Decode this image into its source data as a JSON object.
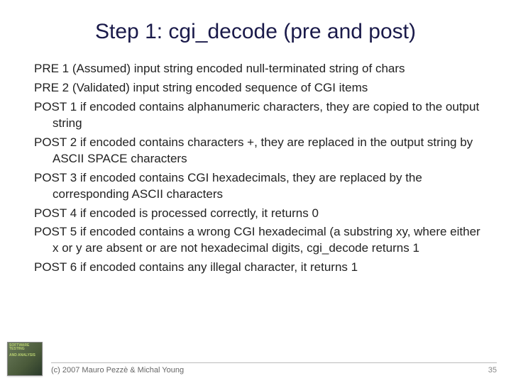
{
  "title": "Step 1: cgi_decode (pre and post)",
  "items": [
    "PRE 1 (Assumed) input string encoded null-terminated string of chars",
    "PRE 2 (Validated) input string encoded sequence of CGI items",
    "POST 1 if encoded contains alphanumeric characters, they are copied to the output string",
    "POST 2 if encoded contains characters +, they are replaced in the output string by ASCII SPACE characters",
    "POST 3 if encoded contains CGI hexadecimals, they are replaced by the corresponding ASCII characters",
    "POST 4 if encoded is processed correctly, it returns 0",
    "POST 5 if encoded contains a wrong CGI hexadecimal (a substring xy, where either x or y are absent or are not hexadecimal digits, cgi_decode returns 1",
    "POST 6 if encoded contains any illegal character, it returns 1"
  ],
  "footer": {
    "copyright": "(c) 2007 Mauro Pezzè & Michal Young",
    "page": "35"
  },
  "logo": {
    "line1": "SOFTWARE TESTING",
    "line2": "AND ANALYSIS"
  }
}
